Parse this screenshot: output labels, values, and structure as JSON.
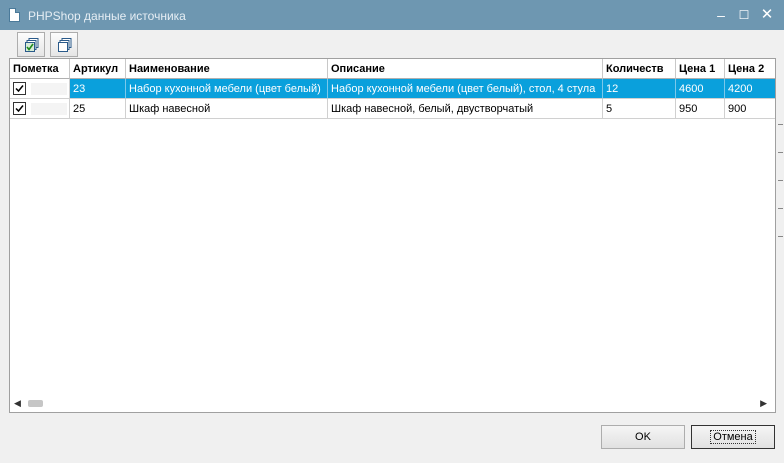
{
  "window": {
    "title": "PHPShop данные источника"
  },
  "toolbar": {
    "buttons": [
      "check-all",
      "uncheck-all"
    ]
  },
  "grid": {
    "columns": [
      "Пометка",
      "Артикул",
      "Наименование",
      "Описание",
      "Количеств",
      "Цена 1",
      "Цена 2"
    ],
    "rows": [
      {
        "checked": true,
        "selected": true,
        "article": "23",
        "name": "Набор кухонной мебели (цвет белый)",
        "description": "Набор кухонной мебели (цвет белый), стол, 4 стула",
        "quantity": "12",
        "price1": "4600",
        "price2": "4200"
      },
      {
        "checked": true,
        "selected": false,
        "article": "25",
        "name": "Шкаф навесной",
        "description": "Шкаф навесной, белый, двустворчатый",
        "quantity": "5",
        "price1": "950",
        "price2": "900"
      }
    ]
  },
  "footer": {
    "ok_label": "OK",
    "cancel_label": "Отмена"
  },
  "colors": {
    "titlebar": "#6e97b1",
    "selection": "#0aa0dc"
  }
}
